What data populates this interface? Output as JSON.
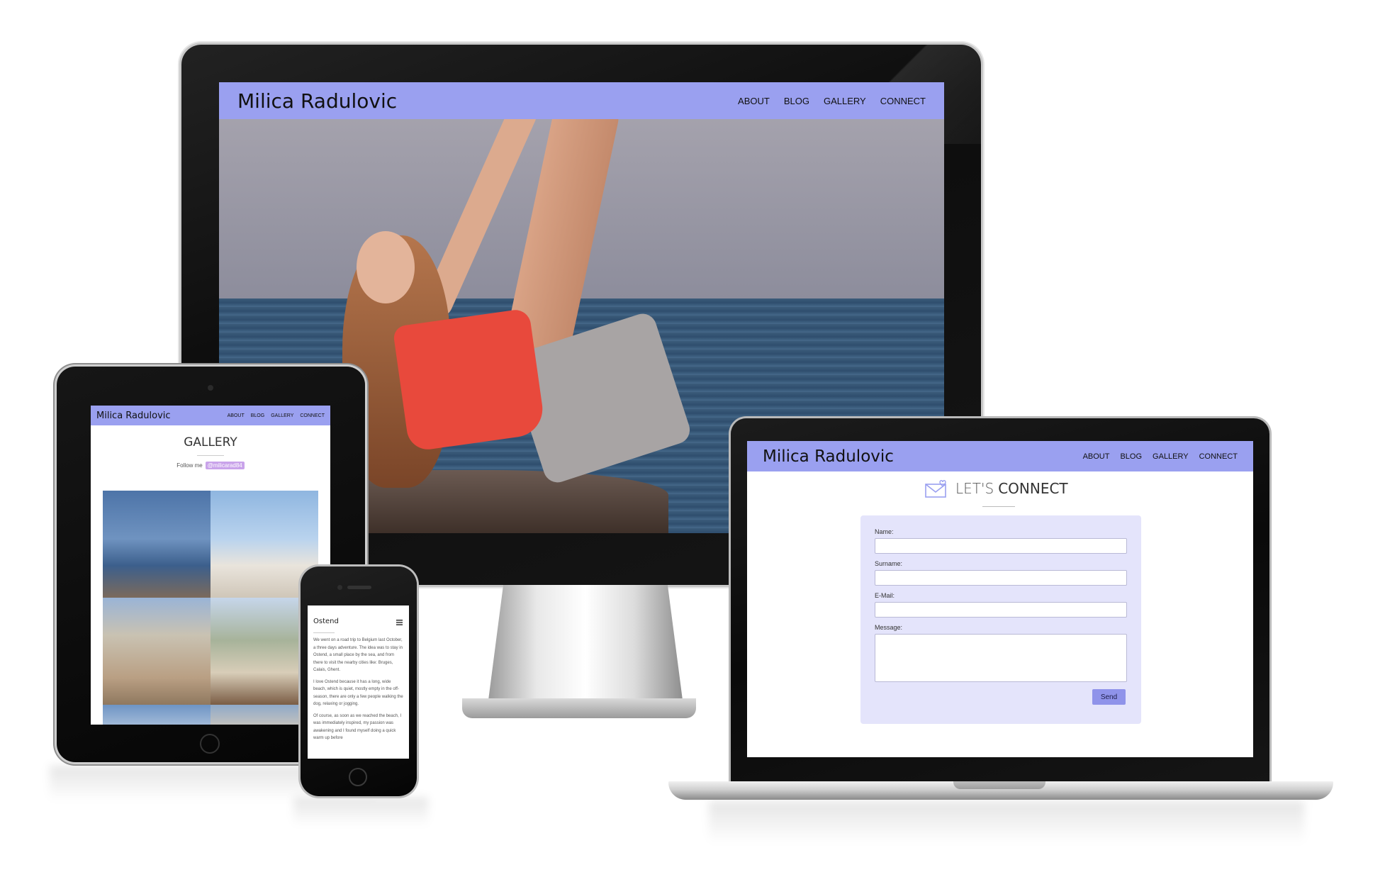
{
  "site": {
    "title": "Milica Radulovic",
    "nav": [
      "ABOUT",
      "BLOG",
      "GALLERY",
      "CONNECT"
    ]
  },
  "gallery": {
    "heading": "GALLERY",
    "follow_text": "Follow me",
    "handle": "@milicarad84"
  },
  "connect": {
    "heading_light": "LET'S",
    "heading_bold": "CONNECT",
    "fields": [
      "Name:",
      "Surname:",
      "E-Mail:",
      "Message:"
    ],
    "send_label": "Send"
  },
  "blog_post": {
    "title": "Ostend",
    "paragraphs": [
      "We went on a road trip to Belgium last October, a three days adventure. The idea was to stay in Ostend, a small place by the sea, and from there to visit the nearby cities like: Bruges, Calais, Ghent.",
      "I love Ostend because it has a long, wide beach, which is quiet, mostly empty in the off-season, there are only a few people walking the dog, relaxing or jogging.",
      "Of course, as soon as we reached the beach, I was immediately inspired, my passion was awakening and I found myself doing a quick warm up before"
    ]
  },
  "colors": {
    "header": "#9aa0f0",
    "form_bg": "#e4e4fb",
    "send_button": "#8f93ea",
    "handle_badge": "#c9a3ea"
  },
  "icons": {
    "menu": "hamburger-icon",
    "connect": "envelope-heart-icon"
  }
}
